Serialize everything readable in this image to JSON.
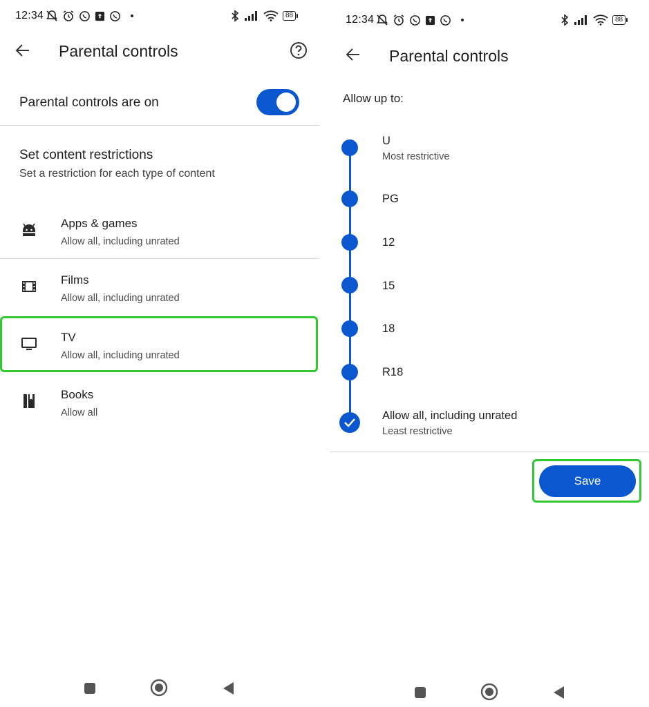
{
  "status_bar": {
    "time": "12:34",
    "battery": "88"
  },
  "left": {
    "title": "Parental controls",
    "toggle_label": "Parental controls are on",
    "toggle_on": true,
    "section_title": "Set content restrictions",
    "section_subtitle": "Set a restriction for each type of content",
    "items": [
      {
        "icon": "android-icon",
        "title": "Apps & games",
        "subtitle": "Allow all, including unrated"
      },
      {
        "icon": "film-icon",
        "title": "Films",
        "subtitle": "Allow all, including unrated"
      },
      {
        "icon": "tv-icon",
        "title": "TV",
        "subtitle": "Allow all, including unrated"
      },
      {
        "icon": "book-icon",
        "title": "Books",
        "subtitle": "Allow all"
      }
    ]
  },
  "right": {
    "title": "Parental controls",
    "allow_label": "Allow up to:",
    "ratings": [
      {
        "label": "U",
        "subtitle": "Most restrictive"
      },
      {
        "label": "PG",
        "subtitle": ""
      },
      {
        "label": "12",
        "subtitle": ""
      },
      {
        "label": "15",
        "subtitle": ""
      },
      {
        "label": "18",
        "subtitle": ""
      },
      {
        "label": "R18",
        "subtitle": ""
      },
      {
        "label": "Allow all, including unrated",
        "subtitle": "Least restrictive",
        "selected": true
      }
    ],
    "save_label": "Save"
  },
  "colors": {
    "accent": "#0b57d0",
    "highlight": "#32c832"
  }
}
